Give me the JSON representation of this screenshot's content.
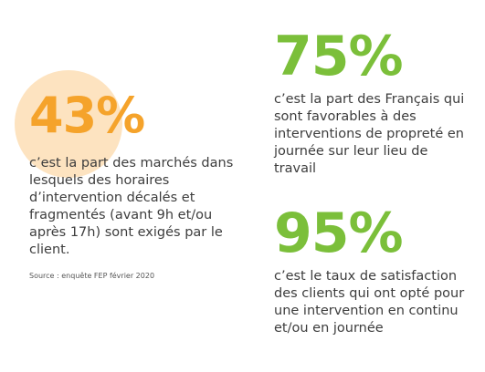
{
  "colors": {
    "orange": "#f5a32b",
    "green": "#7bbf3a",
    "circle": "#fde3c0",
    "text": "#3d3d3d"
  },
  "stat_left": {
    "value": "43%",
    "description": "c’est la part des marchés dans lesquels des horaires d’intervention décalés et fragmentés (avant 9h et/ou après 17h) sont exigés par le client.",
    "source": "Source : enquête FEP février 2020"
  },
  "stat_right_top": {
    "value": "75%",
    "description": "c’est la part des Français qui sont favorables à des interventions de propreté en journée sur leur lieu de travail"
  },
  "stat_right_bottom": {
    "value": "95%",
    "description": "c’est le taux de satisfaction des clients qui ont opté pour une intervention en continu et/ou en journée"
  }
}
